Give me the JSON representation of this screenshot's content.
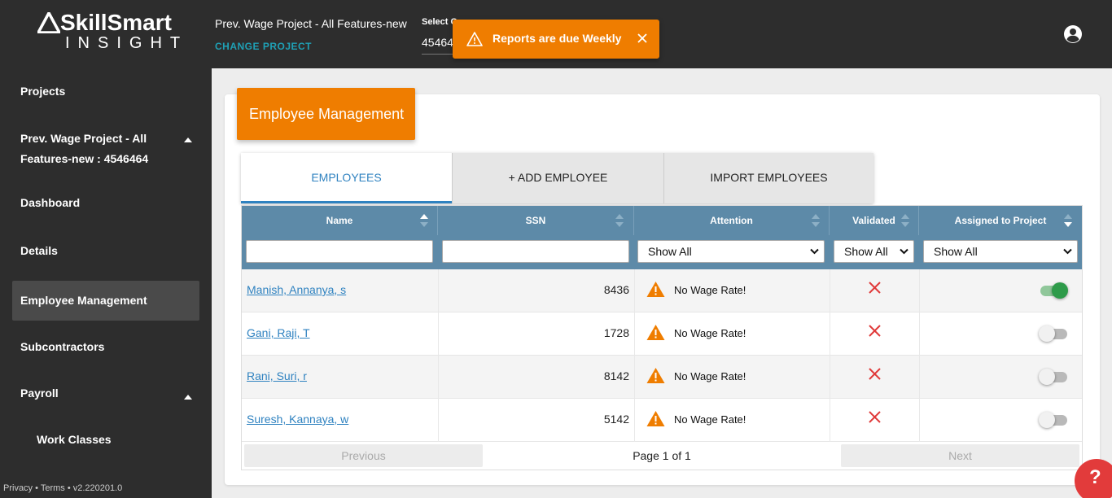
{
  "app": {
    "brand": "SkillSmart",
    "brand_sub": "INSIGHT"
  },
  "header": {
    "project_title": "Prev. Wage Project - All Features-new",
    "change_project": "CHANGE PROJECT",
    "select_label": "Select C",
    "select_value": "45464"
  },
  "toast": {
    "message": "Reports are due Weekly",
    "color": "#ef7d00"
  },
  "sidebar": {
    "projects": "Projects",
    "project_name": "Prev. Wage Project - All Features-new : 4546464",
    "items": [
      {
        "label": "Dashboard"
      },
      {
        "label": "Details"
      },
      {
        "label": "Employee Management"
      },
      {
        "label": "Subcontractors"
      },
      {
        "label": "Payroll"
      },
      {
        "label": "Work Classes"
      }
    ],
    "footer": "Privacy • Terms • v2.220201.0"
  },
  "main": {
    "title": "Employee Management",
    "tabs": [
      {
        "label": "EMPLOYEES"
      },
      {
        "label": "+ ADD EMPLOYEE"
      },
      {
        "label": "IMPORT EMPLOYEES"
      }
    ],
    "table": {
      "columns": [
        "Name",
        "SSN",
        "Attention",
        "Validated",
        "Assigned to Project"
      ],
      "filters": {
        "name": "",
        "ssn": "",
        "attention": "Show All",
        "validated": "Show All",
        "assigned": "Show All"
      },
      "rows": [
        {
          "name": "Manish, Annanya, s",
          "ssn": "8436",
          "attention": "No Wage Rate!",
          "assigned": true
        },
        {
          "name": "Gani, Raji, T",
          "ssn": "1728",
          "attention": "No Wage Rate!",
          "assigned": false
        },
        {
          "name": "Rani, Suri, r",
          "ssn": "8142",
          "attention": "No Wage Rate!",
          "assigned": false
        },
        {
          "name": "Suresh, Kannaya, w",
          "ssn": "5142",
          "attention": "No Wage Rate!",
          "assigned": false
        }
      ]
    },
    "pager": {
      "previous": "Previous",
      "info": "Page 1 of 1",
      "next": "Next"
    }
  },
  "help": {
    "label": "?"
  }
}
